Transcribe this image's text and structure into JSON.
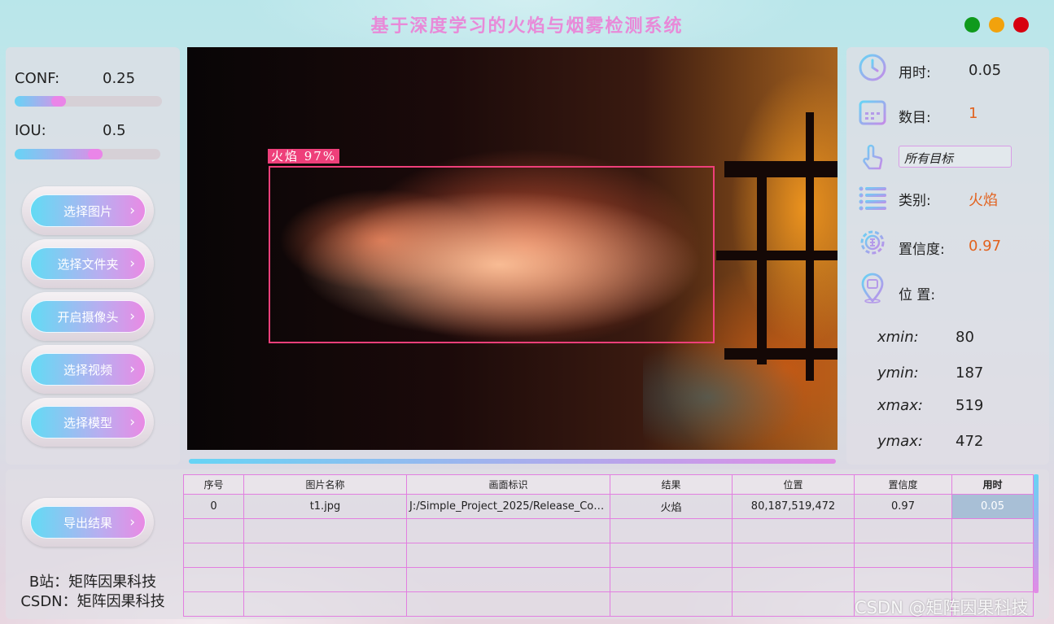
{
  "app": {
    "title": "基于深度学习的火焰与烟雾检测系统"
  },
  "window_controls": {
    "minimize_color": "#0f9a1c",
    "maximize_color": "#f2a20c",
    "close_color": "#d7000f"
  },
  "params": {
    "conf": {
      "label": "CONF:",
      "value": "0.25",
      "level": 0.25
    },
    "iou": {
      "label": "IOU:",
      "value": "0.5",
      "level": 0.5
    }
  },
  "buttons": {
    "select_image": "选择图片",
    "select_folder": "选择文件夹",
    "open_camera": "开启摄像头",
    "select_video": "选择视频",
    "select_model": "选择模型",
    "export_results": "导出结果",
    "chevron": "›"
  },
  "detection": {
    "label": "火焰 97%",
    "progress": 1.0
  },
  "stats": {
    "time_label": "用时:",
    "time_value": "0.05",
    "count_label": "数目:",
    "count_value": "1",
    "target_select": "所有目标",
    "class_label": "类别:",
    "class_value": "火焰",
    "confidence_label": "置信度:",
    "confidence_value": "0.97",
    "position_label": "位 置:",
    "xmin_label": "xmin:",
    "xmin_value": "80",
    "ymin_label": "ymin:",
    "ymin_value": "187",
    "xmax_label": "xmax:",
    "xmax_value": "519",
    "ymax_label": "ymax:",
    "ymax_value": "472"
  },
  "table": {
    "headers": [
      "序号",
      "图片名称",
      "画面标识",
      "结果",
      "位置",
      "置信度",
      "用时"
    ],
    "rows": [
      [
        "0",
        "t1.jpg",
        "J:/Simple_Project_2025/Release_Code...",
        "火焰",
        "80,187,519,472",
        "0.97",
        "0.05"
      ]
    ]
  },
  "footer": {
    "bilibili": "B站：矩阵因果科技",
    "csdn": "CSDN：矩阵因果科技"
  },
  "watermark": "CSDN @矩阵因果科技",
  "colors": {
    "accent_pink": "#e88ad8",
    "accent_cyan": "#66d4f5",
    "value_orange": "#e2621e",
    "bbox": "#ee3f7a"
  },
  "icons": [
    "clock-icon",
    "calendar-icon",
    "hand-pointer-icon",
    "list-icon",
    "gear-icon",
    "location-pin-icon",
    "chevron-right-icon"
  ]
}
